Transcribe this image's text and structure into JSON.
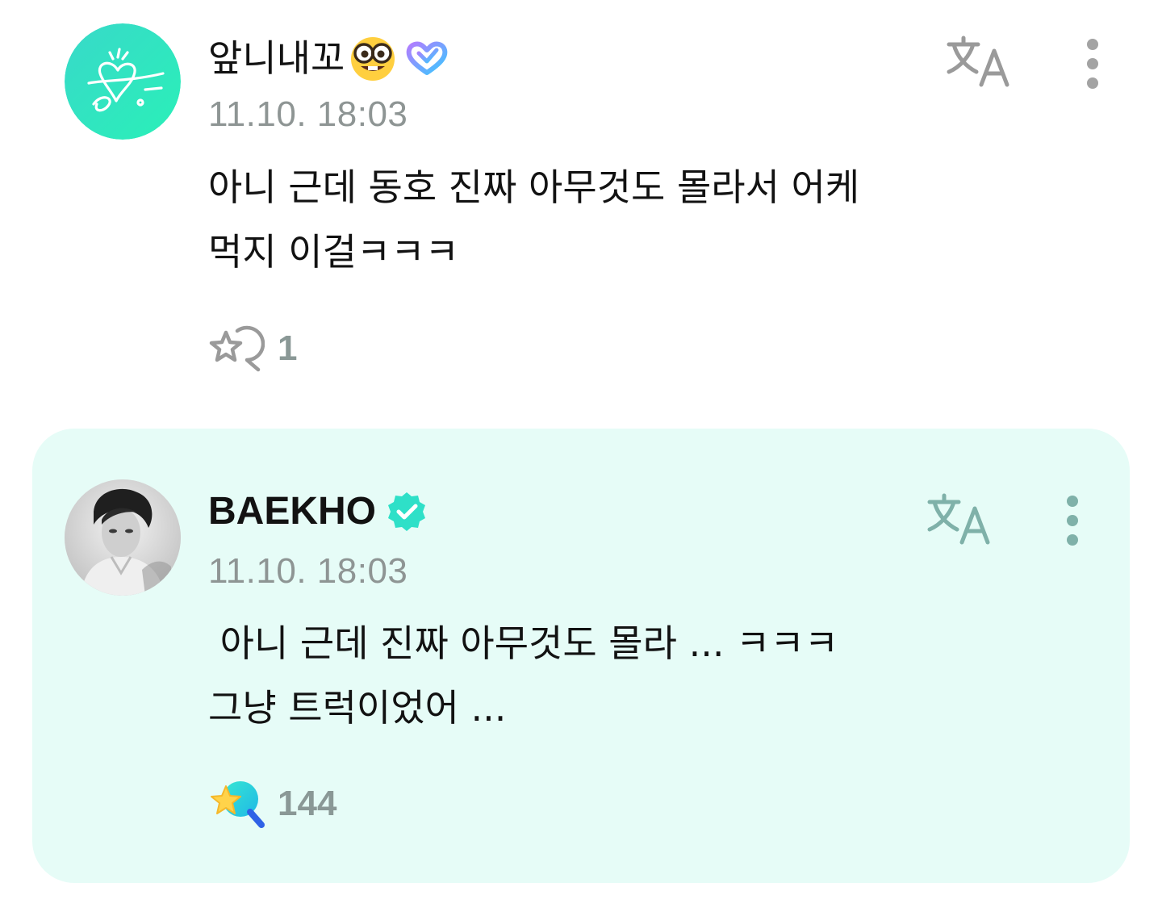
{
  "comment": {
    "author": "앞니내꼬",
    "author_emoji": "nerd-face-emoji",
    "badge": "membership-heart-badge",
    "timestamp": "11.10. 18:03",
    "body_line1": "아니 근데 동호 진짜 아무것도 몰라서 어케",
    "body_line2": "먹지 이걸ㅋㅋㅋ",
    "reaction_count": "1",
    "icons": {
      "translate": "translate-icon",
      "more": "more-vertical-icon",
      "reaction": "reaction-outline-icon"
    }
  },
  "reply": {
    "author": "BAEKHO",
    "badge": "verified-badge",
    "timestamp": "11.10. 18:03",
    "body_line1": " 아니 근데 진짜 아무것도 몰라 ... ㅋㅋㅋ",
    "body_line2": "그냥 트럭이었어 ...",
    "reaction_count": "144",
    "icons": {
      "translate": "translate-icon",
      "more": "more-vertical-icon",
      "reaction": "reaction-filled-icon"
    }
  },
  "colors": {
    "accent_mint": "#2fe3c6",
    "reply_background": "#e6fcf7",
    "muted_text": "#8e9594",
    "icon_gray": "#9a9a9a",
    "icon_teal": "#7fb1a9"
  }
}
